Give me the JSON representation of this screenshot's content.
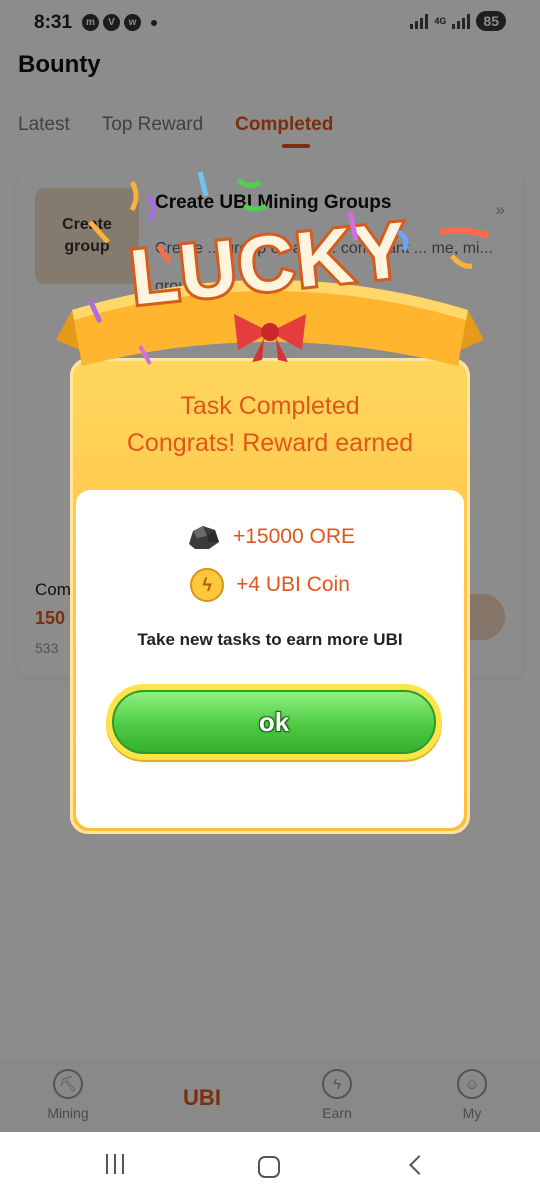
{
  "status_bar": {
    "time": "8:31",
    "icons": [
      "messenger-icon",
      "viber-icon",
      "whatsapp-icon"
    ],
    "network": "4G",
    "battery": "85"
  },
  "app": {
    "title": "Bounty",
    "tabs": [
      {
        "label": "Latest",
        "active": false
      },
      {
        "label": "Top Reward",
        "active": false
      },
      {
        "label": "Completed",
        "active": true
      }
    ]
  },
  "task_card": {
    "thumb_text": "Create group",
    "title": "Create UBI Mining Groups",
    "description": "Create ... group on any ... compliant ... me, mi... group ... 2 ... is",
    "bottom_label": "Com",
    "bottom_value": "150",
    "bottom_count": "533"
  },
  "bottom_nav": {
    "items": [
      {
        "label": "Mining",
        "icon": "mining-icon"
      },
      {
        "label": "UBI",
        "icon": ""
      },
      {
        "label": "Earn",
        "icon": "lightning-icon"
      },
      {
        "label": "My",
        "icon": "smiley-icon"
      }
    ]
  },
  "modal": {
    "banner_text": "LUCKY",
    "heading_line1": "Task Completed",
    "heading_line2": "Congrats! Reward earned",
    "rewards": [
      {
        "icon": "ore-icon",
        "text": "+15000 ORE"
      },
      {
        "icon": "ubi-coin-icon",
        "text": "+4 UBI Coin"
      }
    ],
    "note": "Take new tasks to earn more UBI",
    "ok_label": "ok"
  },
  "colors": {
    "accent": "#e0561b",
    "modal_bg": "#ffc84a",
    "ok_green": "#4fcb45"
  }
}
